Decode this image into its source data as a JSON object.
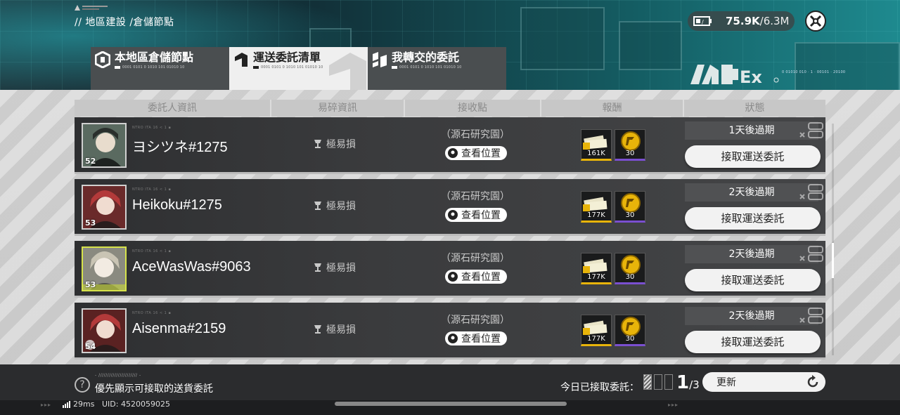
{
  "header": {
    "breadcrumb": "// 地區建設  /倉儲節點",
    "currency_value": "75.9K",
    "currency_max": "/6.3M",
    "brand_code": "0 01010 010 · 1 · 00101 · 20100"
  },
  "tabs": [
    {
      "label": "本地區倉儲節點",
      "sub": "0001 0101 0 1010 101 01010 10",
      "active": false
    },
    {
      "label": "運送委託清單",
      "sub": "0001 0101 0 1010 101 01010 10",
      "active": true
    },
    {
      "label": "我轉交的委託",
      "sub": "0001 0101 0 1010 101 01010 10",
      "active": false
    }
  ],
  "columns": [
    "委託人資訊",
    "易碎資訊",
    "接收點",
    "報酬",
    "狀態"
  ],
  "rows": [
    {
      "name": "ヨシツネ#1275",
      "level": "52",
      "fragile": "極易損",
      "destination": "（源石研究園）",
      "locate_label": "查看位置",
      "reward_money": "161K",
      "reward_token": "30",
      "expire": "1天後過期",
      "accept_label": "接取運送委託",
      "avatar_color": "#5a6a60"
    },
    {
      "name": "Heikoku#1275",
      "level": "53",
      "fragile": "極易損",
      "destination": "（源石研究園）",
      "locate_label": "查看位置",
      "reward_money": "177K",
      "reward_token": "30",
      "expire": "2天後過期",
      "accept_label": "接取運送委託",
      "avatar_color": "#b33a3a"
    },
    {
      "name": "AceWasWas#9063",
      "level": "53",
      "fragile": "極易損",
      "destination": "（源石研究園）",
      "locate_label": "查看位置",
      "reward_money": "177K",
      "reward_token": "30",
      "expire": "2天後過期",
      "accept_label": "接取運送委託",
      "avatar_color": "#c9c4b4"
    },
    {
      "name": "Aisenma#2159",
      "level": "54",
      "fragile": "極易損",
      "destination": "（源石研究園）",
      "locate_label": "查看位置",
      "reward_money": "177K",
      "reward_token": "30",
      "expire": "2天後過期",
      "accept_label": "接取運送委託",
      "avatar_color": "#b33a3a"
    }
  ],
  "footer": {
    "hint_top": "- ////////////////////// -",
    "hint": "優先顯示可接取的送貨委託",
    "today_label": "今日已接取委託：",
    "count_current": "1",
    "count_total": "/3",
    "refresh_label": "更新"
  },
  "status": {
    "ping": "29ms",
    "uid": "UID: 4520059025"
  }
}
